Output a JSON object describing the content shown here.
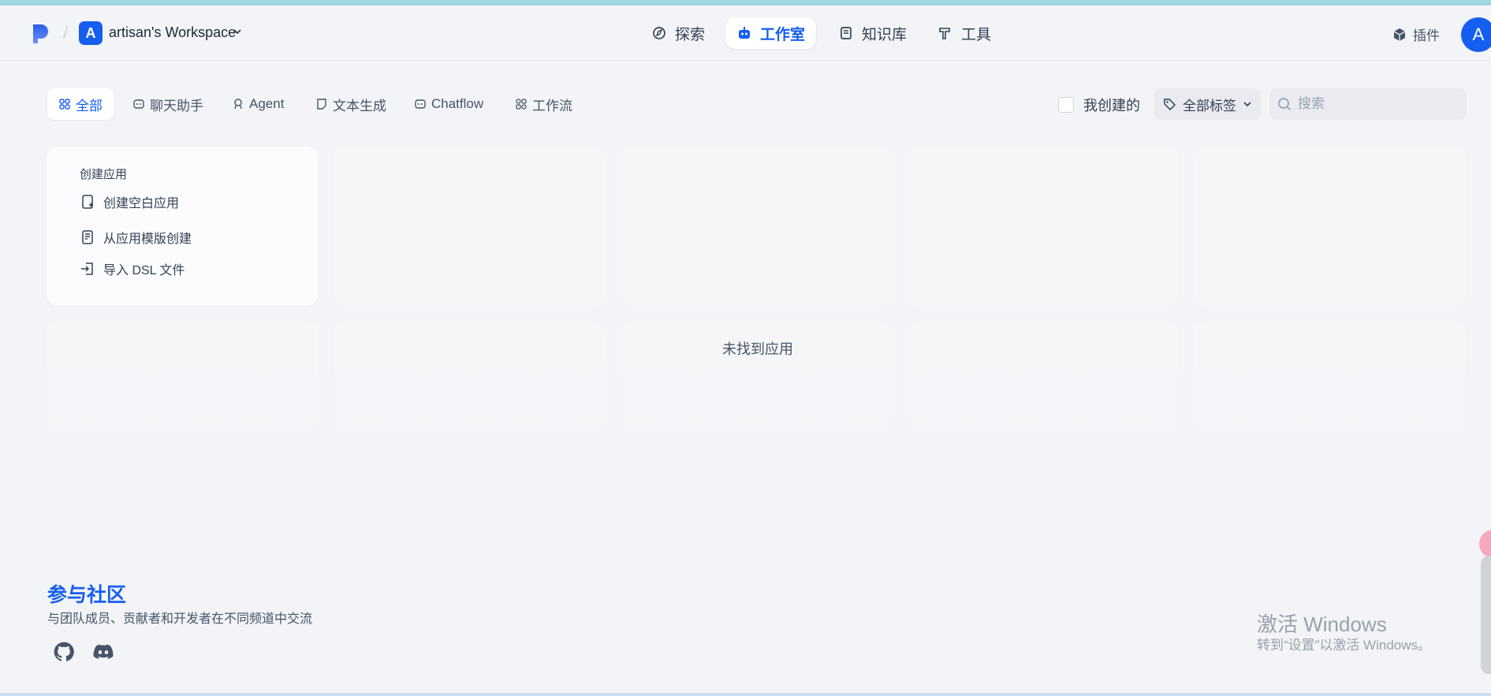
{
  "header": {
    "workspace": {
      "avatar": "A",
      "name": "artisan's Workspace"
    },
    "nav": [
      {
        "label": "探索",
        "icon": "compass-icon"
      },
      {
        "label": "工作室",
        "icon": "robot-icon",
        "active": true
      },
      {
        "label": "知识库",
        "icon": "book-icon"
      },
      {
        "label": "工具",
        "icon": "hammer-icon"
      }
    ],
    "plugin_label": "插件",
    "user_avatar": "A"
  },
  "filters": {
    "tabs": [
      {
        "label": "全部",
        "active": true
      },
      {
        "label": "聊天助手"
      },
      {
        "label": "Agent"
      },
      {
        "label": "文本生成"
      },
      {
        "label": "Chatflow"
      },
      {
        "label": "工作流"
      }
    ],
    "mine_label": "我创建的",
    "tags_label": "全部标签",
    "search_placeholder": "搜索"
  },
  "create": {
    "title": "创建应用",
    "items": [
      "创建空白应用",
      "从应用模版创建",
      "导入 DSL 文件"
    ]
  },
  "empty_text": "未找到应用",
  "community": {
    "title": "参与社区",
    "desc": "与团队成员、贡献者和开发者在不同频道中交流"
  },
  "watermark": {
    "line1": "激活 Windows",
    "line2": "转到“设置”以激活 Windows。"
  },
  "colors": {
    "accent": "#155eef",
    "background": "#f2f4f7"
  }
}
